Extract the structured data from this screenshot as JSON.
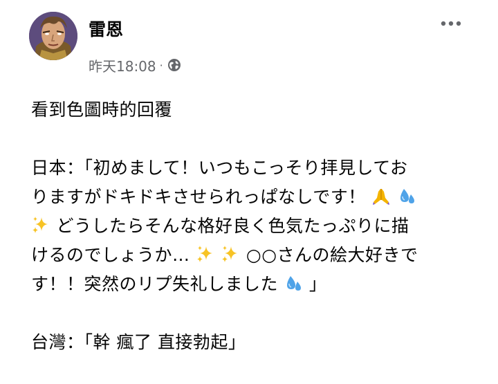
{
  "author": {
    "name": "雷恩"
  },
  "meta": {
    "time": "昨天18:08",
    "separator": "·",
    "privacy_icon": "globe-icon"
  },
  "more_icon": "more-horizontal-icon",
  "post": {
    "title_line": "看到色圖時的回覆",
    "jp_lines": {
      "l1": "日本：「初めまして！いつもこっそり拝見してお",
      "l2": "りますがドキドキさせられっぱなしです！",
      "l3": "どうしたらそんな格好良く色気たっぷりに描",
      "l4a": "けるのでしょうか…",
      "l4b": "○○さんの絵大好きで",
      "l5a": "す！！突然のリプ失礼しました",
      "l5b": "」"
    },
    "tw_line": "台灣：「幹 瘋了 直接勃起」",
    "emoji": {
      "pray": "folded-hands-emoji",
      "sweat": "sweat-droplets-emoji",
      "sparkles": "sparkles-emoji"
    }
  },
  "colors": {
    "text": "#050505",
    "secondary": "#65676b",
    "sparkle": "#f7c325",
    "droplet": "#4fa3e8",
    "hands": "#f4b400"
  }
}
